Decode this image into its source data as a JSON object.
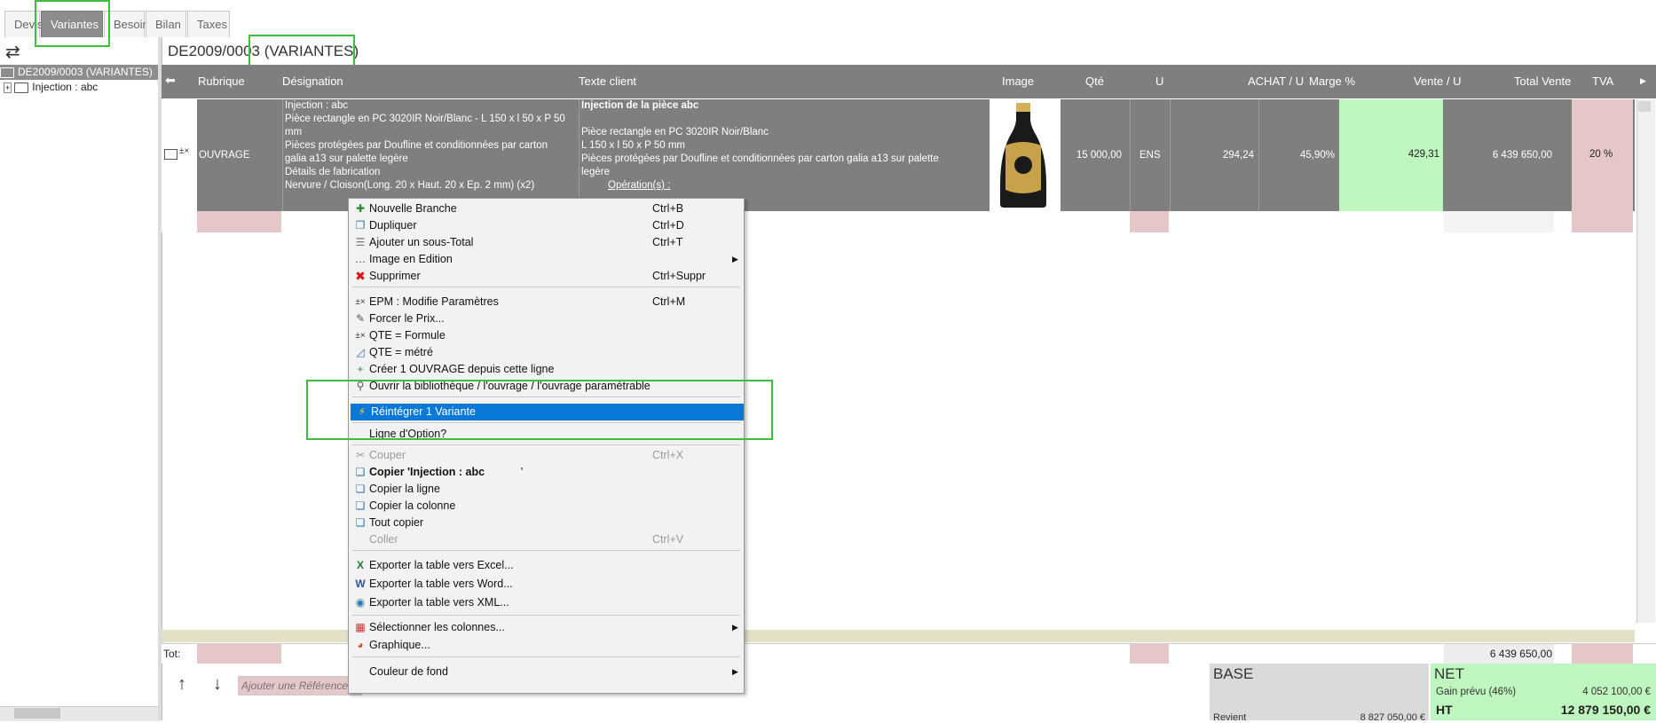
{
  "tabs": [
    {
      "label": "Devis",
      "active": false
    },
    {
      "label": "Variantes",
      "active": true
    },
    {
      "label": "Besoin",
      "active": false
    },
    {
      "label": "Bilan",
      "active": false
    },
    {
      "label": "Taxes",
      "active": false
    }
  ],
  "left_panel": {
    "root_label": "DE2009/0003 (VARIANTES)",
    "child_label": "Injection : abc"
  },
  "document_title": "DE2009/0003 (VARIANTES)",
  "grid": {
    "headers": [
      "Rubrique",
      "Désignation",
      "Texte client",
      "Image",
      "Qté",
      "U",
      "ACHAT / U",
      "Marge %",
      "Vente / U",
      "Total Vente",
      "TVA"
    ],
    "row": {
      "rubrique": "OUVRAGE",
      "designation": [
        "Injection : abc",
        "Pièce rectangle en PC 3020IR Noir/Blanc - L 150 x l 50 x P 50",
        "mm",
        "Pièces protégées par Doufline et conditionnées par carton",
        "galia a13 sur palette legère",
        "Détails de fabrication",
        "Nervure / Cloison(Long. 20 x Haut. 20 x Ep. 2 mm) (x2)"
      ],
      "texte_client_title": "Injection de la pièce abc",
      "texte_client": [
        "Pièce rectangle en PC 3020IR Noir/Blanc",
        "L 150 x l 50 x P 50 mm",
        "Pièces protégées par Doufline et conditionnées par carton galia a13 sur palette",
        "legère"
      ],
      "texte_client_ops": "Opération(s) :",
      "qte": "15 000,00",
      "unite": "ENS",
      "achat": "294,24",
      "marge": "45,90%",
      "vente": "429,31",
      "total": "6 439 650,00",
      "tva": "20 %"
    },
    "total_label": "Tot:",
    "total_value": "6 439 650,00"
  },
  "bottom": {
    "add_ref_placeholder": "Ajouter une Référence",
    "base_title": "BASE",
    "base_line_label": "Revient",
    "base_line_value": "8 827 050,00 €",
    "net_title": "NET",
    "gain_label": "Gain prévu (46%)",
    "gain_value": "4 052 100,00 €",
    "ht_label": "HT",
    "ht_value": "12 879 150,00 €"
  },
  "context_menu": {
    "items": [
      {
        "label": "Nouvelle Branche",
        "shortcut": "Ctrl+B",
        "icon": "new-branch-icon"
      },
      {
        "label": "Dupliquer",
        "shortcut": "Ctrl+D",
        "icon": "duplicate-icon"
      },
      {
        "label": "Ajouter un sous-Total",
        "shortcut": "Ctrl+T",
        "icon": "subtotal-icon"
      },
      {
        "label": "Image en Edition",
        "shortcut": "",
        "icon": "ellipsis-icon",
        "submenu": true
      },
      {
        "label": "Supprimer",
        "shortcut": "Ctrl+Suppr",
        "icon": "delete-icon"
      },
      {
        "label": "EPM : Modifie Paramètres",
        "shortcut": "Ctrl+M",
        "icon": "params-icon"
      },
      {
        "label": "Forcer le Prix...",
        "shortcut": "",
        "icon": "force-price-icon"
      },
      {
        "label": "QTE = Formule",
        "shortcut": "",
        "icon": "formula-icon"
      },
      {
        "label": "QTE = métré",
        "shortcut": "",
        "icon": "measure-icon"
      },
      {
        "label": "Créer 1 OUVRAGE depuis cette ligne",
        "shortcut": "",
        "icon": "create-icon"
      },
      {
        "label": "Ouvrir la bibliothèque / l'ouvrage / l'ouvrage paramétrable",
        "shortcut": "",
        "icon": "library-icon"
      },
      {
        "label": "Réintégrer 1 Variante",
        "shortcut": "",
        "icon": "reintegrate-icon",
        "selected": true
      },
      {
        "label": "Ligne d'Option?",
        "shortcut": "",
        "icon": ""
      },
      {
        "label": "Couper",
        "shortcut": "Ctrl+X",
        "icon": "scissors-icon",
        "disabled": true
      },
      {
        "label": "Copier 'Injection : abc",
        "shortcut": "'",
        "icon": "copy-icon"
      },
      {
        "label": "Copier la ligne",
        "shortcut": "",
        "icon": "copy-row-icon"
      },
      {
        "label": "Copier la colonne",
        "shortcut": "",
        "icon": "copy-column-icon"
      },
      {
        "label": "Tout copier",
        "shortcut": "",
        "icon": "copy-all-icon"
      },
      {
        "label": "Coller",
        "shortcut": "Ctrl+V",
        "icon": "paste-icon",
        "disabled": true
      },
      {
        "label": "Exporter la table vers Excel...",
        "shortcut": "",
        "icon": "excel-icon"
      },
      {
        "label": "Exporter la table vers Word...",
        "shortcut": "",
        "icon": "word-icon"
      },
      {
        "label": "Exporter la table vers XML...",
        "shortcut": "",
        "icon": "xml-icon"
      },
      {
        "label": "Sélectionner les colonnes...",
        "shortcut": "",
        "icon": "columns-icon",
        "submenu": true
      },
      {
        "label": "Graphique...",
        "shortcut": "",
        "icon": "chart-icon"
      },
      {
        "label": "Couleur de fond",
        "shortcut": "",
        "icon": "",
        "submenu": true
      }
    ]
  },
  "colors": {
    "highlight": "#3cbf3c",
    "header_grey": "#7f7f7f",
    "sell_green": "#bff5bf",
    "pink": "#e6c7c9",
    "menu_selection": "#0a78d7"
  }
}
